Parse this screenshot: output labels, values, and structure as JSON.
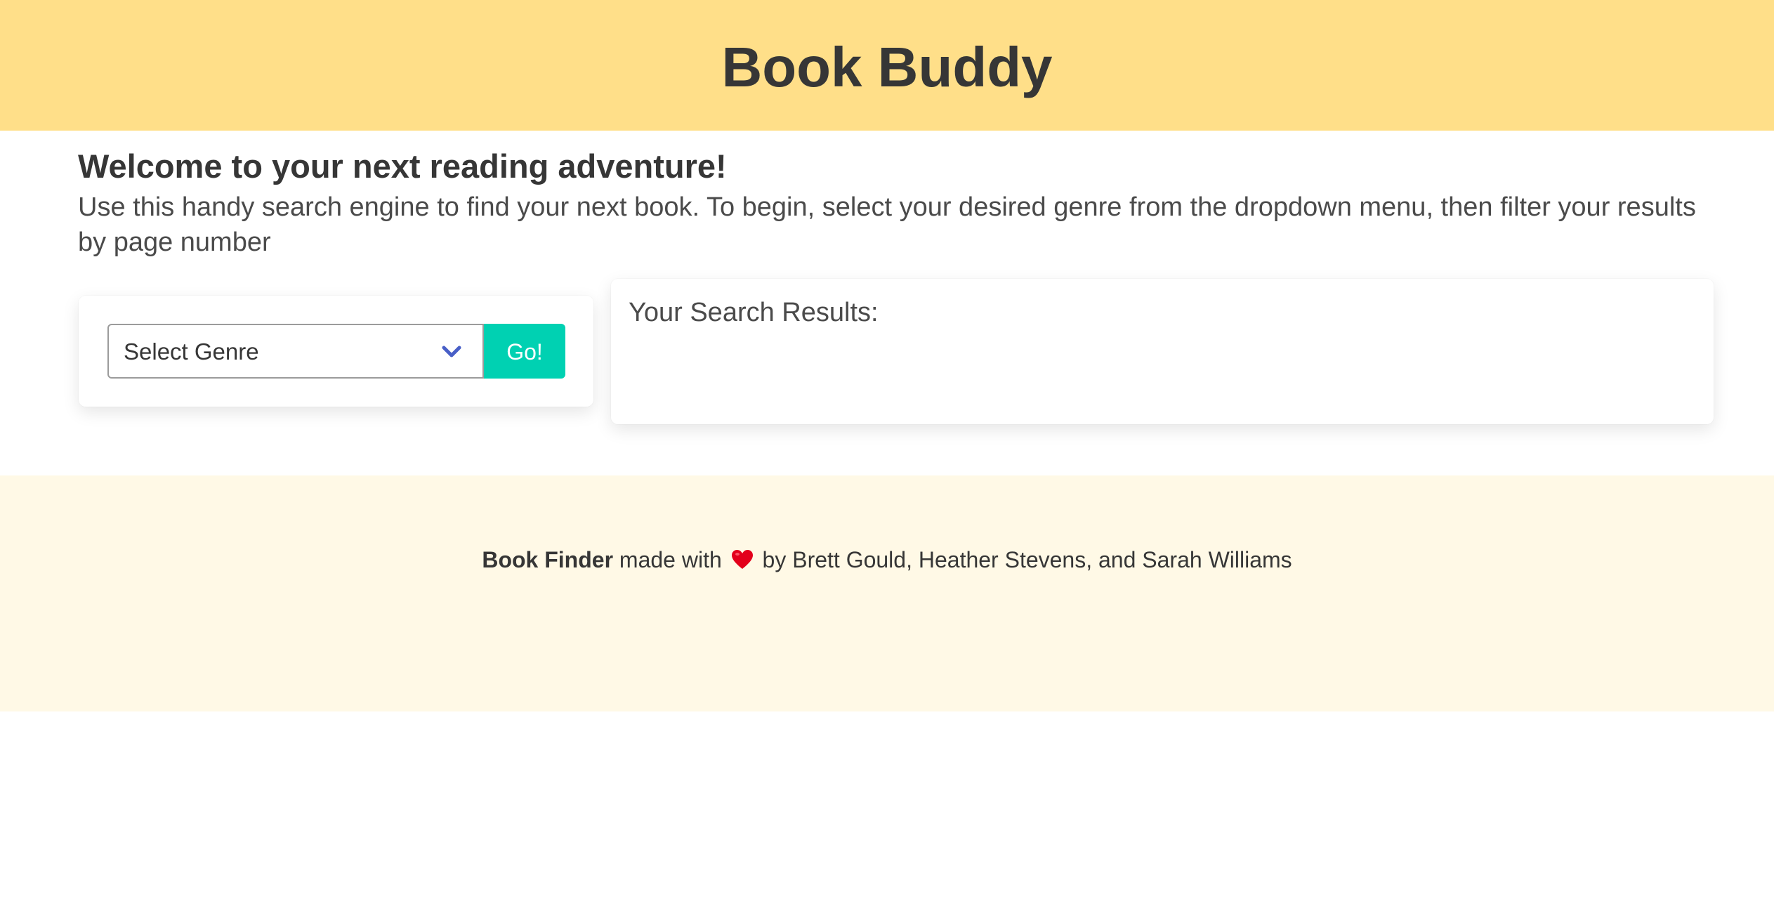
{
  "hero": {
    "title": "Book Buddy"
  },
  "intro": {
    "heading": "Welcome to your next reading adventure!",
    "description": "Use this handy search engine to find your next book. To begin, select your desired genre from the dropdown menu, then filter your results by page number"
  },
  "search": {
    "genre_select_label": "Select Genre",
    "go_button_label": "Go!"
  },
  "results": {
    "title": "Your Search Results:"
  },
  "footer": {
    "brand": "Book Finder",
    "made_with": "made with",
    "credits": "by Brett Gould, Heather Stevens, and Sarah Williams"
  },
  "colors": {
    "hero_background": "#ffdf89",
    "footer_background": "#fff9e6",
    "go_button": "#00d1b2",
    "chevron": "#485fc7",
    "heart": "#e3001b"
  },
  "icons": {
    "dropdown": "chevron-down-icon",
    "love": "heart-icon"
  }
}
